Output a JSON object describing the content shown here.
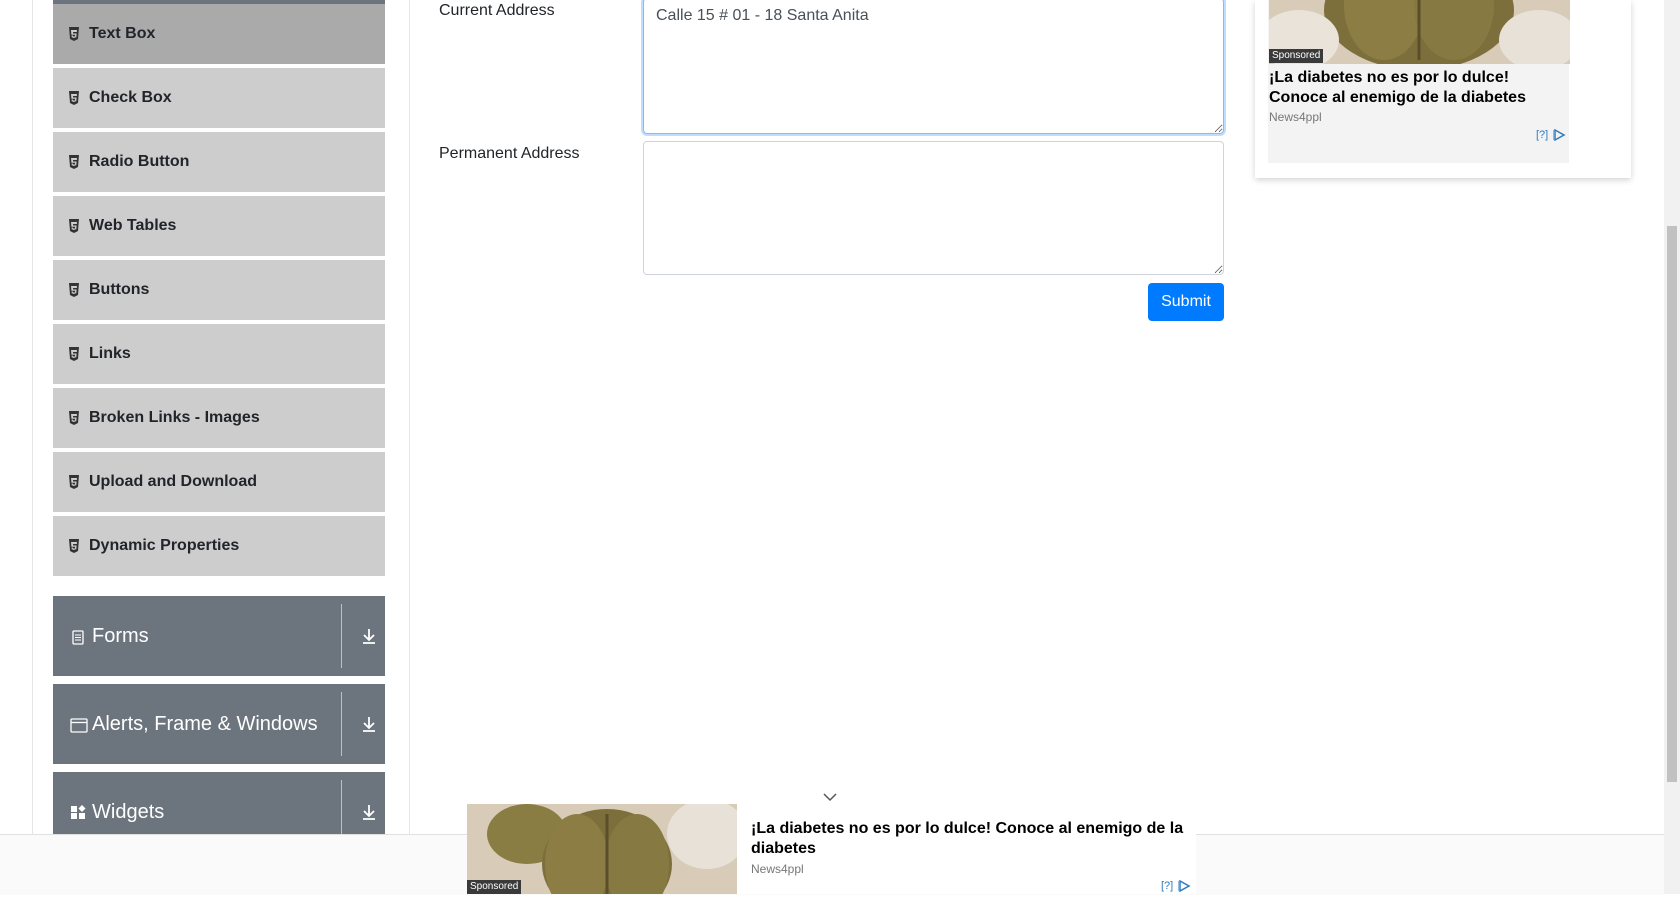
{
  "sidebar": {
    "elements": [
      {
        "label": "Text Box",
        "active": true
      },
      {
        "label": "Check Box"
      },
      {
        "label": "Radio Button"
      },
      {
        "label": "Web Tables"
      },
      {
        "label": "Buttons"
      },
      {
        "label": "Links"
      },
      {
        "label": "Broken Links - Images"
      },
      {
        "label": "Upload and Download"
      },
      {
        "label": "Dynamic Properties"
      }
    ],
    "groups": [
      {
        "label": "Forms",
        "icon": "document-icon"
      },
      {
        "label": "Alerts, Frame & Windows",
        "icon": "window-icon"
      },
      {
        "label": "Widgets",
        "icon": "widgets-icon"
      }
    ]
  },
  "form": {
    "current_address_label": "Current Address",
    "current_address_value": "Calle 15 # 01 - 18 Santa Anita",
    "permanent_address_label": "Permanent Address",
    "permanent_address_value": "",
    "submit_label": "Submit"
  },
  "ad_right": {
    "sponsored": "Sponsored",
    "title": "¡La diabetes no es por lo dulce! Conoce al enemigo de la diabetes",
    "source": "News4ppl",
    "adchoice": "[?]"
  },
  "ad_bottom": {
    "sponsored": "Sponsored",
    "title": "¡La diabetes no es por lo dulce! Conoce al enemigo de la diabetes",
    "source": "News4ppl",
    "adchoice": "[?]"
  },
  "colors": {
    "primary": "#007bff",
    "group_bg": "#6c757d",
    "item_bg": "#cdcdcd",
    "item_active_bg": "#aaaaaa"
  }
}
